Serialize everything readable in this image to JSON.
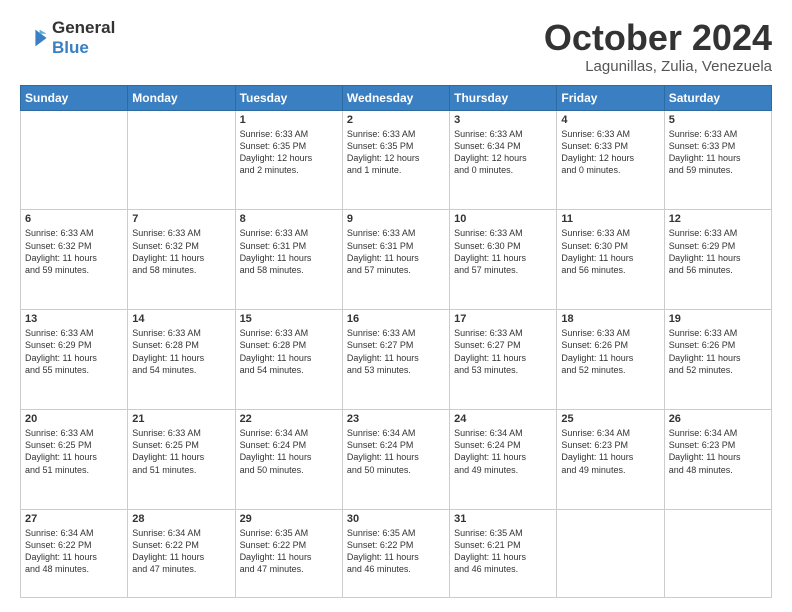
{
  "header": {
    "logo_line1": "General",
    "logo_line2": "Blue",
    "title": "October 2024",
    "location": "Lagunillas, Zulia, Venezuela"
  },
  "weekdays": [
    "Sunday",
    "Monday",
    "Tuesday",
    "Wednesday",
    "Thursday",
    "Friday",
    "Saturday"
  ],
  "weeks": [
    [
      {
        "day": "",
        "info": ""
      },
      {
        "day": "",
        "info": ""
      },
      {
        "day": "1",
        "info": "Sunrise: 6:33 AM\nSunset: 6:35 PM\nDaylight: 12 hours\nand 2 minutes."
      },
      {
        "day": "2",
        "info": "Sunrise: 6:33 AM\nSunset: 6:35 PM\nDaylight: 12 hours\nand 1 minute."
      },
      {
        "day": "3",
        "info": "Sunrise: 6:33 AM\nSunset: 6:34 PM\nDaylight: 12 hours\nand 0 minutes."
      },
      {
        "day": "4",
        "info": "Sunrise: 6:33 AM\nSunset: 6:33 PM\nDaylight: 12 hours\nand 0 minutes."
      },
      {
        "day": "5",
        "info": "Sunrise: 6:33 AM\nSunset: 6:33 PM\nDaylight: 11 hours\nand 59 minutes."
      }
    ],
    [
      {
        "day": "6",
        "info": "Sunrise: 6:33 AM\nSunset: 6:32 PM\nDaylight: 11 hours\nand 59 minutes."
      },
      {
        "day": "7",
        "info": "Sunrise: 6:33 AM\nSunset: 6:32 PM\nDaylight: 11 hours\nand 58 minutes."
      },
      {
        "day": "8",
        "info": "Sunrise: 6:33 AM\nSunset: 6:31 PM\nDaylight: 11 hours\nand 58 minutes."
      },
      {
        "day": "9",
        "info": "Sunrise: 6:33 AM\nSunset: 6:31 PM\nDaylight: 11 hours\nand 57 minutes."
      },
      {
        "day": "10",
        "info": "Sunrise: 6:33 AM\nSunset: 6:30 PM\nDaylight: 11 hours\nand 57 minutes."
      },
      {
        "day": "11",
        "info": "Sunrise: 6:33 AM\nSunset: 6:30 PM\nDaylight: 11 hours\nand 56 minutes."
      },
      {
        "day": "12",
        "info": "Sunrise: 6:33 AM\nSunset: 6:29 PM\nDaylight: 11 hours\nand 56 minutes."
      }
    ],
    [
      {
        "day": "13",
        "info": "Sunrise: 6:33 AM\nSunset: 6:29 PM\nDaylight: 11 hours\nand 55 minutes."
      },
      {
        "day": "14",
        "info": "Sunrise: 6:33 AM\nSunset: 6:28 PM\nDaylight: 11 hours\nand 54 minutes."
      },
      {
        "day": "15",
        "info": "Sunrise: 6:33 AM\nSunset: 6:28 PM\nDaylight: 11 hours\nand 54 minutes."
      },
      {
        "day": "16",
        "info": "Sunrise: 6:33 AM\nSunset: 6:27 PM\nDaylight: 11 hours\nand 53 minutes."
      },
      {
        "day": "17",
        "info": "Sunrise: 6:33 AM\nSunset: 6:27 PM\nDaylight: 11 hours\nand 53 minutes."
      },
      {
        "day": "18",
        "info": "Sunrise: 6:33 AM\nSunset: 6:26 PM\nDaylight: 11 hours\nand 52 minutes."
      },
      {
        "day": "19",
        "info": "Sunrise: 6:33 AM\nSunset: 6:26 PM\nDaylight: 11 hours\nand 52 minutes."
      }
    ],
    [
      {
        "day": "20",
        "info": "Sunrise: 6:33 AM\nSunset: 6:25 PM\nDaylight: 11 hours\nand 51 minutes."
      },
      {
        "day": "21",
        "info": "Sunrise: 6:33 AM\nSunset: 6:25 PM\nDaylight: 11 hours\nand 51 minutes."
      },
      {
        "day": "22",
        "info": "Sunrise: 6:34 AM\nSunset: 6:24 PM\nDaylight: 11 hours\nand 50 minutes."
      },
      {
        "day": "23",
        "info": "Sunrise: 6:34 AM\nSunset: 6:24 PM\nDaylight: 11 hours\nand 50 minutes."
      },
      {
        "day": "24",
        "info": "Sunrise: 6:34 AM\nSunset: 6:24 PM\nDaylight: 11 hours\nand 49 minutes."
      },
      {
        "day": "25",
        "info": "Sunrise: 6:34 AM\nSunset: 6:23 PM\nDaylight: 11 hours\nand 49 minutes."
      },
      {
        "day": "26",
        "info": "Sunrise: 6:34 AM\nSunset: 6:23 PM\nDaylight: 11 hours\nand 48 minutes."
      }
    ],
    [
      {
        "day": "27",
        "info": "Sunrise: 6:34 AM\nSunset: 6:22 PM\nDaylight: 11 hours\nand 48 minutes."
      },
      {
        "day": "28",
        "info": "Sunrise: 6:34 AM\nSunset: 6:22 PM\nDaylight: 11 hours\nand 47 minutes."
      },
      {
        "day": "29",
        "info": "Sunrise: 6:35 AM\nSunset: 6:22 PM\nDaylight: 11 hours\nand 47 minutes."
      },
      {
        "day": "30",
        "info": "Sunrise: 6:35 AM\nSunset: 6:22 PM\nDaylight: 11 hours\nand 46 minutes."
      },
      {
        "day": "31",
        "info": "Sunrise: 6:35 AM\nSunset: 6:21 PM\nDaylight: 11 hours\nand 46 minutes."
      },
      {
        "day": "",
        "info": ""
      },
      {
        "day": "",
        "info": ""
      }
    ]
  ]
}
